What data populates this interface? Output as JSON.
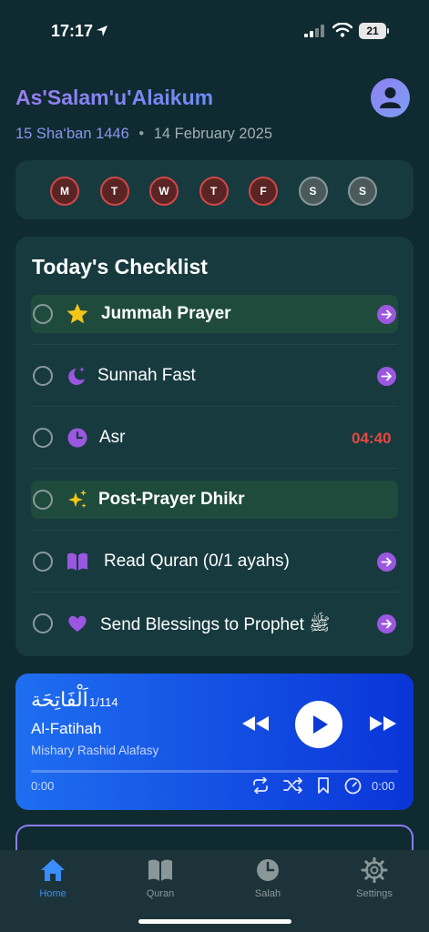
{
  "status_bar": {
    "time": "17:17",
    "battery": "21"
  },
  "header": {
    "greeting": "As'Salam'u'Alaikum",
    "hijri_date": "15 Sha‘ban 1446",
    "separator": "•",
    "gregorian_date": "14 February 2025"
  },
  "week": [
    {
      "label": "M",
      "state": "active"
    },
    {
      "label": "T",
      "state": "active"
    },
    {
      "label": "W",
      "state": "active"
    },
    {
      "label": "T",
      "state": "active"
    },
    {
      "label": "F",
      "state": "active"
    },
    {
      "label": "S",
      "state": "inactive"
    },
    {
      "label": "S",
      "state": "inactive"
    }
  ],
  "checklist": {
    "title": "Today's Checklist",
    "items": [
      {
        "label": "Jummah Prayer",
        "icon": "star-icon",
        "highlight": true,
        "bold": true,
        "action": "arrow"
      },
      {
        "label": "Sunnah Fast",
        "icon": "moon-stars-icon",
        "highlight": false,
        "bold": false,
        "action": "arrow"
      },
      {
        "label": "Asr",
        "icon": "clock-icon",
        "highlight": false,
        "bold": false,
        "action": "countdown",
        "countdown": "04:40"
      },
      {
        "label": "Post-Prayer Dhikr",
        "icon": "sparkles-icon",
        "highlight": true,
        "bold": true,
        "action": "none"
      },
      {
        "label": "Read Quran (0/1 ayahs)",
        "icon": "book-icon",
        "highlight": false,
        "bold": false,
        "action": "arrow"
      },
      {
        "label": "Send Blessings to Prophet ﷺ",
        "icon": "heart-icon",
        "highlight": false,
        "bold": false,
        "action": "arrow"
      }
    ]
  },
  "player": {
    "surah_arabic": "اَلْفَاتِحَة",
    "surah_number": "1/114",
    "surah_name": "Al-Fatihah",
    "reciter": "Mishary Rashid Alafasy",
    "current_time": "0:00",
    "duration": "0:00",
    "progress": 0
  },
  "tabs": [
    {
      "label": "Home",
      "icon": "home-icon",
      "active": true
    },
    {
      "label": "Quran",
      "icon": "book-icon",
      "active": false
    },
    {
      "label": "Salah",
      "icon": "clock-icon",
      "active": false
    },
    {
      "label": "Settings",
      "icon": "gear-icon",
      "active": false
    }
  ],
  "colors": {
    "accent_purple": "#9b57e0",
    "alert_red": "#e8473f",
    "tab_active": "#3a8dff"
  }
}
